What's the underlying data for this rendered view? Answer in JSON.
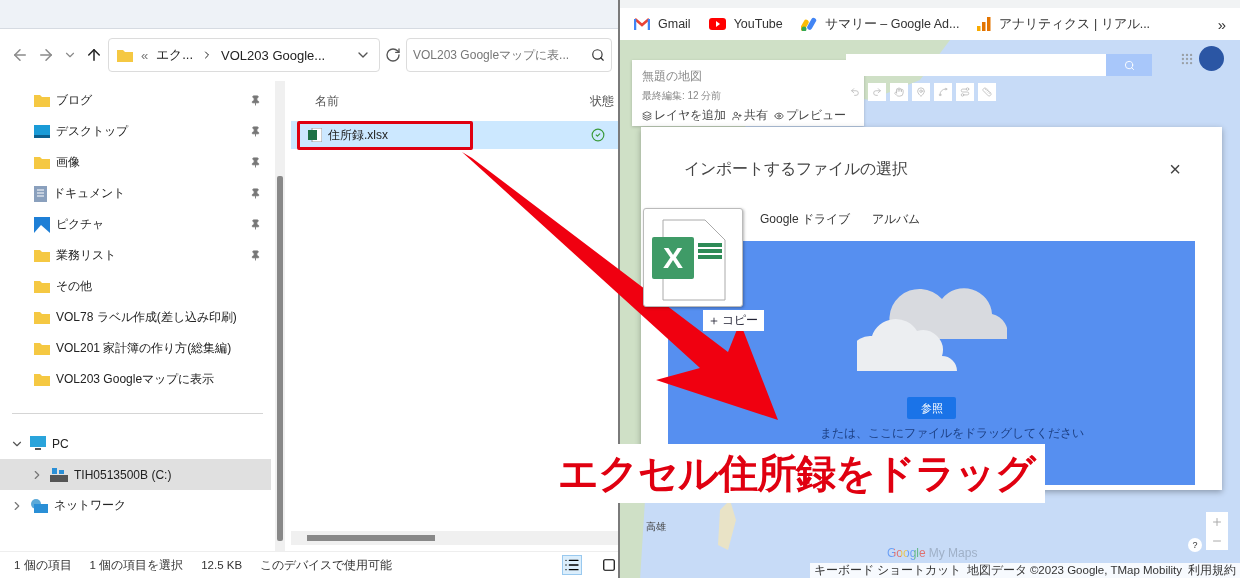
{
  "explorer": {
    "address_bar": {
      "overflow": "«",
      "segments": [
        "エク...",
        "VOL203 Google..."
      ]
    },
    "search": {
      "placeholder": "VOL203 Googleマップに表..."
    },
    "quick_access": [
      {
        "label": "ブログ",
        "kind": "folder",
        "pinned": true
      },
      {
        "label": "デスクトップ",
        "kind": "desktop",
        "pinned": true
      },
      {
        "label": "画像",
        "kind": "folder",
        "pinned": true
      },
      {
        "label": "ドキュメント",
        "kind": "document",
        "pinned": true
      },
      {
        "label": "ピクチャ",
        "kind": "picture",
        "pinned": true
      },
      {
        "label": "業務リスト",
        "kind": "folder",
        "pinned": true
      },
      {
        "label": "その他",
        "kind": "folder",
        "pinned": false
      },
      {
        "label": "VOL78 ラベル作成(差し込み印刷)",
        "kind": "folder",
        "pinned": false
      },
      {
        "label": "VOL201 家計簿の作り方(総集編)",
        "kind": "folder",
        "pinned": false
      },
      {
        "label": "VOL203 Googleマップに表示",
        "kind": "folder",
        "pinned": false
      }
    ],
    "tree": [
      {
        "label": "PC",
        "kind": "pc",
        "expanded": true,
        "selected": false,
        "children": [
          {
            "label": "TIH0513500B (C:)",
            "kind": "drive",
            "expanded": false,
            "selected": true
          }
        ]
      },
      {
        "label": "ネットワーク",
        "kind": "network",
        "expanded": false,
        "selected": false
      }
    ],
    "columns": [
      "名前",
      "状態"
    ],
    "rows": [
      {
        "name": "住所録.xlsx",
        "selected": true,
        "highlighted": true,
        "synced": true
      }
    ],
    "status_bar": [
      "1 個の項目",
      "1 個の項目を選択",
      "12.5 KB",
      "このデバイスで使用可能"
    ],
    "view_buttons": [
      {
        "kind": "details",
        "selected": true
      },
      {
        "kind": "preview",
        "selected": false
      }
    ]
  },
  "browser": {
    "bookmarks": [
      {
        "label": "Gmail",
        "kind": "gmail"
      },
      {
        "label": "YouTube",
        "kind": "youtube"
      },
      {
        "label": "サマリー – Google Ad...",
        "kind": "ads"
      },
      {
        "label": "アナリティクス | リアル...",
        "kind": "analytics"
      }
    ],
    "more": "»"
  },
  "map": {
    "panel": {
      "title": "無題の地図",
      "subtitle": "最終編集: 12 分前",
      "actions": [
        {
          "label": "レイヤを追加",
          "kind": "layers"
        },
        {
          "label": "共有",
          "kind": "share"
        },
        {
          "label": "プレビュー",
          "kind": "preview"
        }
      ]
    },
    "labels": [
      "高雄"
    ],
    "logo": {
      "brand": "Google",
      "product": "My Maps"
    },
    "footer": [
      "キーボード ショートカット",
      "地図データ ©2023 Google, TMap Mobility",
      "利用規約"
    ],
    "help": "?"
  },
  "dialog": {
    "title": "インポートするファイルの選択",
    "close": "×",
    "tabs": [
      {
        "label": "Google ドライブ",
        "selected": false
      },
      {
        "label": "アルバム",
        "selected": false
      }
    ],
    "browse_button": "参照",
    "drop_hint": "または、ここにファイルをドラッグしてください"
  },
  "drag": {
    "icon_letter": "X",
    "copy_label": "コピー"
  },
  "caption": "エクセル住所録をドラッグ"
}
